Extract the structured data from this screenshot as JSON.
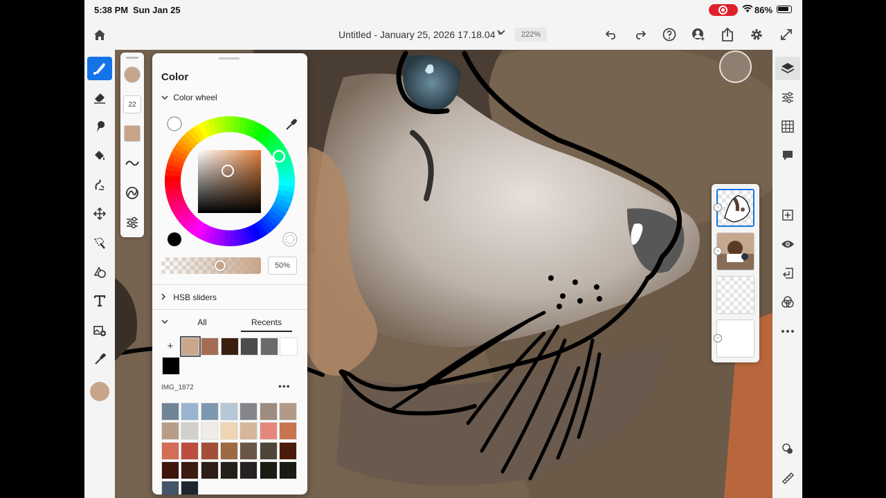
{
  "status_bar": {
    "time": "5:38 PM",
    "date": "Sun Jan 25",
    "battery": "86%"
  },
  "top_bar": {
    "title": "Untitled - January 25, 2026 17.18.04 *",
    "zoom": "222%"
  },
  "brush_options": {
    "size": "22"
  },
  "color_panel": {
    "title": "Color",
    "color_wheel_label": "Color wheel",
    "opacity": "50%",
    "hsb_label": "HSB sliders",
    "tabs": [
      "All",
      "Recents"
    ],
    "add_label": "+",
    "recent_swatches": [
      "#c9a68c",
      "#a26d52",
      "#3a1e10",
      "#4c4c4c",
      "#6a6a6a",
      "#ffffff",
      "#000000"
    ],
    "library_name": "IMG_1872",
    "library_more": "•••",
    "palette": [
      [
        "#6f8497",
        "#9ab4cf",
        "#7c98b0",
        "#b6c7d6",
        "#86858a",
        "#9e8c80",
        "#b29a89"
      ],
      [
        "#b79d88",
        "#d2d0cd",
        "#efebe6",
        "#efd5b4",
        "#d6b799",
        "#e6877b",
        "#c9744f"
      ],
      [
        "#d46d55",
        "#bd4d3e",
        "#a34f37",
        "#9e6a41",
        "#6a5648",
        "#4f4539",
        "#4a1c09"
      ],
      [
        "#3d150d",
        "#3b1a10",
        "#2d1e18",
        "#241f17",
        "#272020",
        "#1b1b12",
        "#191c14"
      ],
      [
        "#44556a",
        "#1f252c"
      ]
    ],
    "selected_color": "#c7a58a",
    "hue_color": "#e0803a"
  },
  "colors": {
    "accent": "#1473e6",
    "toolbar_bg": "#f4f4f4",
    "record": "#e0202b"
  }
}
